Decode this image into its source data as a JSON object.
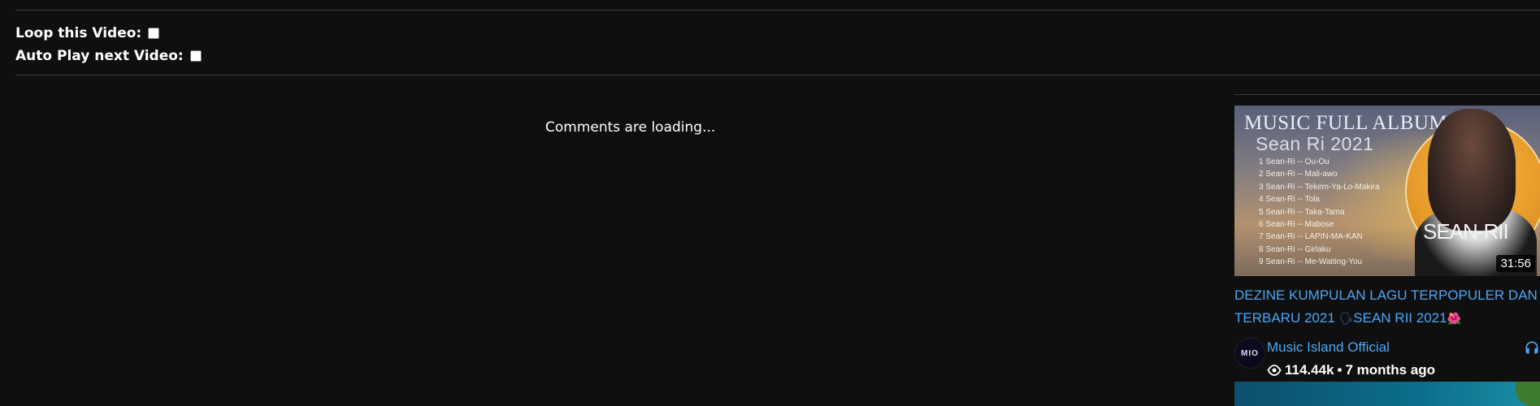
{
  "options": {
    "loop_label": "Loop this Video:",
    "autoplay_label": "Auto Play next Video:"
  },
  "comments": {
    "loading_text": "Comments are loading..."
  },
  "related": {
    "video": {
      "thumbnail": {
        "line1": "MUSIC FULL ALBUM",
        "line2": "Sean Ri 2021",
        "tracks": [
          "1 Sean-Ri -- Ou-Ou",
          "2 Sean-Ri -- Mali-awo",
          "3 Sean-Ri -- Tekem-Ya-Lo-Makira",
          "4 Sean-Ri -- Tola",
          "5 Sean-Ri -- Taka-Tama",
          "6 Sean-Ri -- Mabose",
          "7 Sean-Ri -- LAPIN-MA-KAN",
          "8 Sean-Ri -- Girlaku",
          "9 Sean-Ri -- Me-Waiting-You"
        ],
        "overlay_name": "SEAN-RII"
      },
      "duration": "31:56",
      "title_part1": "DEZINE KUMPULAN LAGU TERPOPULER DAN TERBARU 2021 ",
      "title_emoji1": "🗣",
      "title_part2": "SEAN RII 2021",
      "title_emoji2": "🌺",
      "channel_name": "Music Island Official",
      "channel_avatar_text": "MIO",
      "views": "114.44k",
      "separator": "•",
      "age": "7 months ago"
    }
  },
  "icons": {
    "eye": "eye-icon",
    "headphones": "headphones-icon",
    "checkbox": "checkbox"
  },
  "colors": {
    "background": "#0f0f0f",
    "link": "#4ea6f5",
    "text": "#ffffff",
    "divider": "#3a3a3a"
  }
}
